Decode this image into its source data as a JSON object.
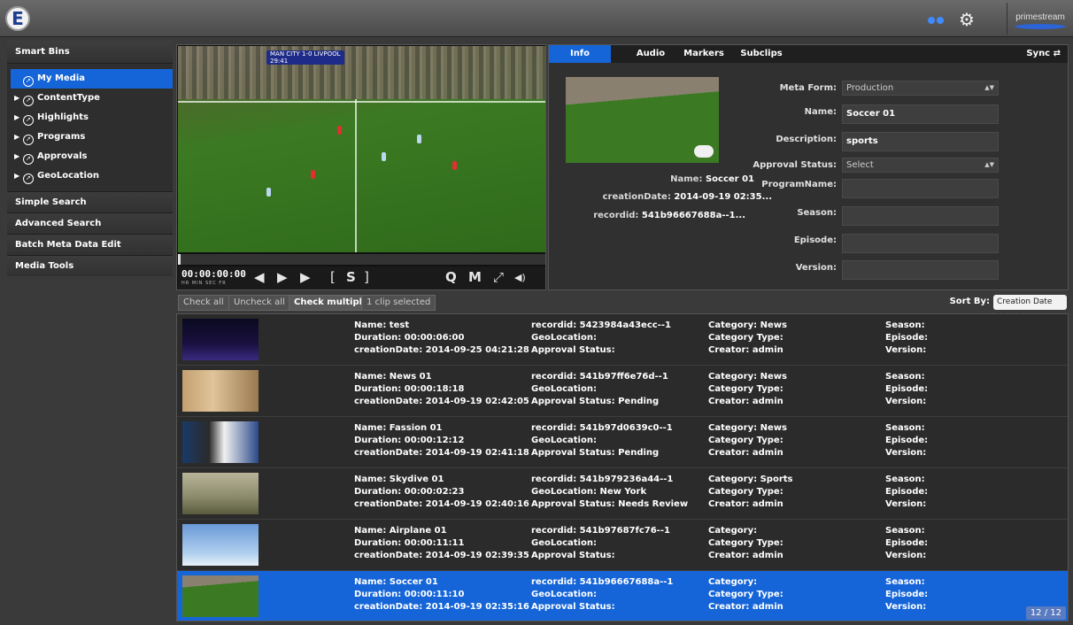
{
  "app": {
    "logo_letter": "E",
    "brand": "primestream",
    "accent": "#1565d8"
  },
  "sidebar": {
    "header": "Smart Bins",
    "items": [
      {
        "label": "My Media",
        "selected": true,
        "icon": "compass-icon"
      },
      {
        "label": "ContentType",
        "icon": "compass-icon"
      },
      {
        "label": "Highlights",
        "icon": "compass-icon"
      },
      {
        "label": "Programs",
        "icon": "compass-icon"
      },
      {
        "label": "Approvals",
        "icon": "compass-icon"
      },
      {
        "label": "GeoLocation",
        "icon": "compass-icon"
      }
    ],
    "sections": [
      "Simple Search",
      "Advanced Search",
      "Batch Meta Data Edit",
      "Media Tools"
    ]
  },
  "player": {
    "timecode": "00:00:00:00",
    "timecode_units": "HR MIN SEC FR",
    "scorebug_line1": "MAN CITY 1-0 LIVPOOL",
    "scorebug_line2": "29:41",
    "buttons": {
      "rewind": "◀",
      "play": "▶",
      "forward": "▶",
      "mark_in": "[",
      "s": "S",
      "mark_out": "]",
      "q": "Q",
      "m": "M",
      "fullscreen": "⤢",
      "volume": "◀)"
    }
  },
  "info": {
    "tabs": [
      "Info",
      "Audio",
      "Markers",
      "Subclips"
    ],
    "sync_label": "Sync",
    "name_label": "Name:",
    "name_value": "Soccer 01",
    "creation_label": "creationDate:",
    "creation_value": "2014-09-19 02:35...",
    "recordid_label": "recordid:",
    "recordid_value": "541b96667688a--1...",
    "form": {
      "meta_form_label": "Meta Form:",
      "meta_form_value": "Production",
      "name_label": "Name:",
      "name_value": "Soccer 01",
      "description_label": "Description:",
      "description_value": "sports",
      "approval_label": "Approval Status:",
      "approval_value": "Select",
      "program_label": "ProgramName:",
      "season_label": "Season:",
      "episode_label": "Episode:",
      "version_label": "Version:"
    }
  },
  "listbar": {
    "check_all": "Check all",
    "uncheck_all": "Uncheck all",
    "check_multiple": "Check multiple",
    "selected_count": "1 clip selected",
    "sort_label": "Sort By:",
    "sort_value": "Creation Date (desc)"
  },
  "clips": [
    {
      "name": "Name: test",
      "duration": "Duration: 00:00:06:00",
      "created": "creationDate: 2014-09-25 04:21:28",
      "recordid": "recordid: 5423984a43ecc--1",
      "geo": "GeoLocation:",
      "approval": "Approval Status:",
      "category": "Category: News",
      "category_type": "Category Type:",
      "creator": "Creator: admin",
      "season": "Season:",
      "episode": "Episode:",
      "version": "Version:"
    },
    {
      "name": "Name: News 01",
      "duration": "Duration: 00:00:18:18",
      "created": "creationDate: 2014-09-19 02:42:05",
      "recordid": "recordid: 541b97ff6e76d--1",
      "geo": "GeoLocation:",
      "approval": "Approval Status: Pending",
      "category": "Category: News",
      "category_type": "Category Type:",
      "creator": "Creator: admin",
      "season": "Season:",
      "episode": "Episode:",
      "version": "Version:"
    },
    {
      "name": "Name: Fassion 01",
      "duration": "Duration: 00:00:12:12",
      "created": "creationDate: 2014-09-19 02:41:18",
      "recordid": "recordid: 541b97d0639c0--1",
      "geo": "GeoLocation:",
      "approval": "Approval Status: Pending",
      "category": "Category: News",
      "category_type": "Category Type:",
      "creator": "Creator: admin",
      "season": "Season:",
      "episode": "Episode:",
      "version": "Version:"
    },
    {
      "name": "Name: Skydive 01",
      "duration": "Duration: 00:00:02:23",
      "created": "creationDate: 2014-09-19 02:40:16",
      "recordid": "recordid: 541b979236a44--1",
      "geo": "GeoLocation: New York",
      "approval": "Approval Status: Needs Review",
      "category": "Category: Sports",
      "category_type": "Category Type:",
      "creator": "Creator: admin",
      "season": "Season:",
      "episode": "Episode:",
      "version": "Version:"
    },
    {
      "name": "Name: Airplane 01",
      "duration": "Duration: 00:00:11:11",
      "created": "creationDate: 2014-09-19 02:39:35",
      "recordid": "recordid: 541b97687fc76--1",
      "geo": "GeoLocation:",
      "approval": "Approval Status:",
      "category": "Category:",
      "category_type": "Category Type:",
      "creator": "Creator: admin",
      "season": "Season:",
      "episode": "Episode:",
      "version": "Version:"
    },
    {
      "name": "Name: Soccer 01",
      "duration": "Duration: 00:00:11:10",
      "created": "creationDate: 2014-09-19 02:35:16",
      "recordid": "recordid: 541b96667688a--1",
      "geo": "GeoLocation:",
      "approval": "Approval Status:",
      "category": "Category:",
      "category_type": "Category Type:",
      "creator": "Creator: admin",
      "season": "Season:",
      "episode": "Episode:",
      "version": "Version:",
      "selected": true
    }
  ],
  "pager": "12 / 12"
}
